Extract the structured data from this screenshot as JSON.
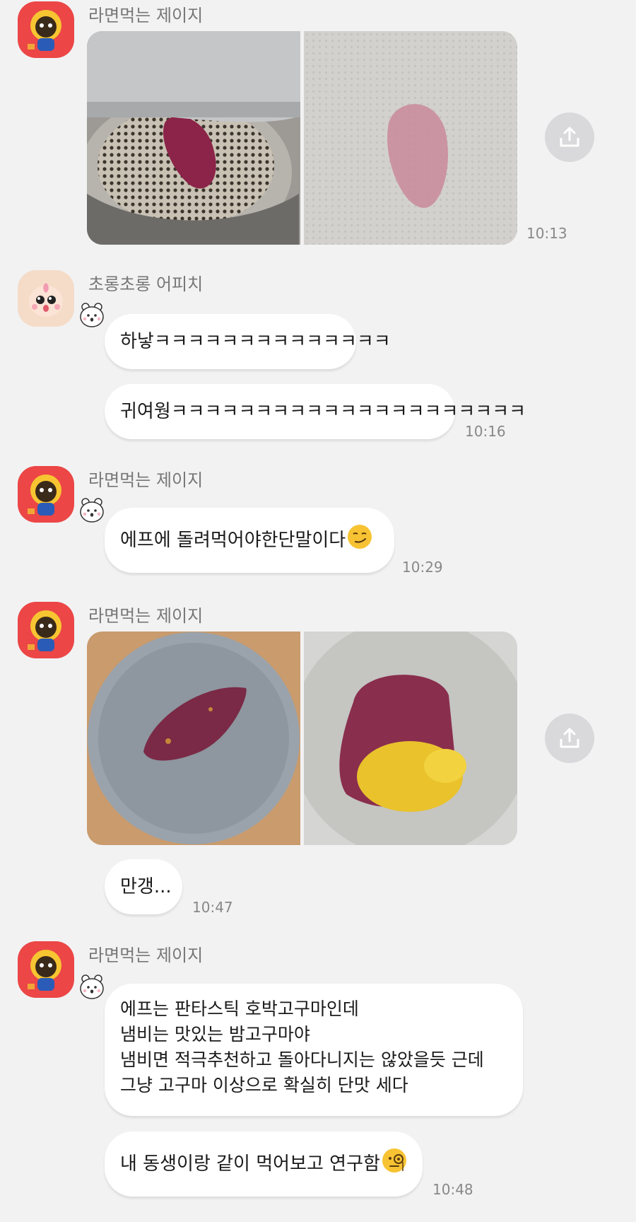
{
  "messages": [
    {
      "sender": "라면먹는 제이지",
      "time": "10:13"
    },
    {
      "sender": "초롱초롱 어피치",
      "texts": [
        "하낳ㅋㅋㅋㅋㅋㅋㅋㅋㅋㅋㅋㅋㅋㅋ",
        "귀여웡ㅋㅋㅋㅋㅋㅋㅋㅋㅋㅋㅋㅋㅋㅋㅋㅋㅋㅋㅋㅋㅋ"
      ],
      "time": "10:16"
    },
    {
      "sender": "라면먹는 제이지",
      "text": "에프에 돌려먹어야한단말이다",
      "time": "10:29"
    },
    {
      "sender": "라면먹는 제이지",
      "text": "만갱...",
      "time": "10:47"
    },
    {
      "sender": "라면먹는 제이지",
      "lines": [
        "에프는 판타스틱 호박고구마인데",
        "냄비는 맛있는 밤고구마야",
        "냄비면 적극추천하고 돌아다니지는 않았을듯 근데",
        "그냥 고구마 이상으로 확실히 단맛 세다"
      ],
      "text2": "내 동생이랑 같이 먹어보고 연구함",
      "time": "10:48"
    }
  ],
  "icons": {
    "share": "share-upload-icon",
    "smirk": "smirking-face-emoji",
    "monocle": "face-with-monocle-emoji"
  },
  "colors": {
    "background": "#f2f2f3",
    "bubble": "#ffffff",
    "ryan_avatar": "#ec4646"
  }
}
